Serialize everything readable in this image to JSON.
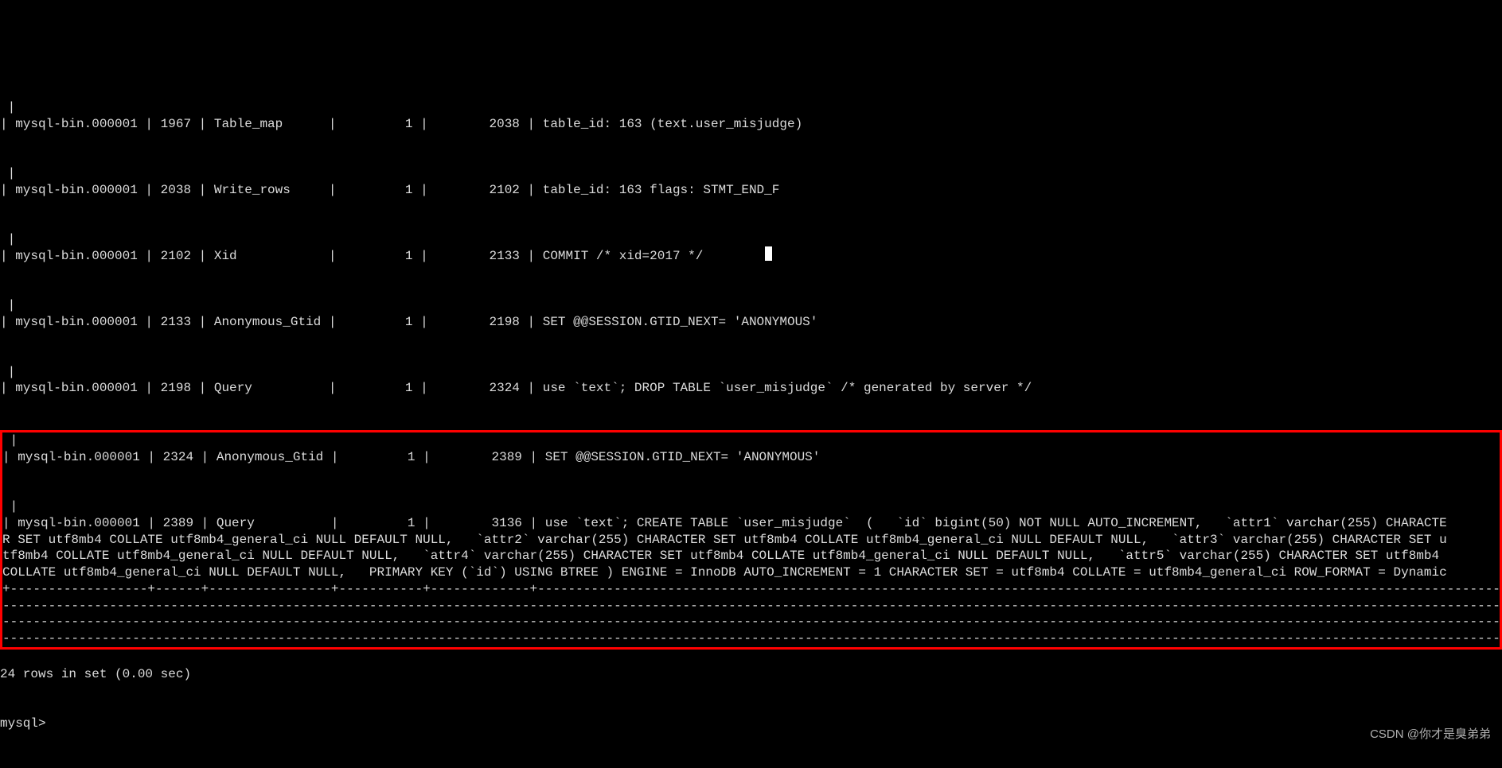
{
  "rows": [
    {
      "line1": " |",
      "line2": "| mysql-bin.000001 | 1967 | Table_map      |         1 |        2038 | table_id: 163 (text.user_misjudge)"
    },
    {
      "line1": " |",
      "line2": "| mysql-bin.000001 | 2038 | Write_rows     |         1 |        2102 | table_id: 163 flags: STMT_END_F"
    },
    {
      "line1": " |",
      "line2": "| mysql-bin.000001 | 2102 | Xid            |         1 |        2133 | COMMIT /* xid=2017 */"
    },
    {
      "line1": " |",
      "line2": "| mysql-bin.000001 | 2133 | Anonymous_Gtid |         1 |        2198 | SET @@SESSION.GTID_NEXT= 'ANONYMOUS'"
    },
    {
      "line1": " |",
      "line2": "| mysql-bin.000001 | 2198 | Query          |         1 |        2324 | use `text`; DROP TABLE `user_misjudge` /* generated by server */"
    }
  ],
  "hrows": [
    {
      "line1": " |",
      "line2": "| mysql-bin.000001 | 2324 | Anonymous_Gtid |         1 |        2389 | SET @@SESSION.GTID_NEXT= 'ANONYMOUS'"
    },
    {
      "line1": " |",
      "line2": "| mysql-bin.000001 | 2389 | Query          |         1 |        3136 | use `text`; CREATE TABLE `user_misjudge`  (   `id` bigint(50) NOT NULL AUTO_INCREMENT,   `attr1` varchar(255) CHARACTE",
      "line3": "R SET utf8mb4 COLLATE utf8mb4_general_ci NULL DEFAULT NULL,   `attr2` varchar(255) CHARACTER SET utf8mb4 COLLATE utf8mb4_general_ci NULL DEFAULT NULL,   `attr3` varchar(255) CHARACTER SET u",
      "line4": "tf8mb4 COLLATE utf8mb4_general_ci NULL DEFAULT NULL,   `attr4` varchar(255) CHARACTER SET utf8mb4 COLLATE utf8mb4_general_ci NULL DEFAULT NULL,   `attr5` varchar(255) CHARACTER SET utf8mb4 ",
      "line5": "COLLATE utf8mb4_general_ci NULL DEFAULT NULL,   PRIMARY KEY (`id`) USING BTREE ) ENGINE = InnoDB AUTO_INCREMENT = 1 CHARACTER SET = utf8mb4 COLLATE = utf8mb4_general_ci ROW_FORMAT = Dynamic"
    }
  ],
  "sep1": "+------------------+------+----------------+-----------+-------------+-------------------------------------------------------------------------------------------------------------------------------------------------------------------------------------------------",
  "sep2": "-------------------------------------------------------------------------------------------------------------------------------------------------------------------------------------------------------------------------------------------------------------------------",
  "sep3": "-------------------------------------------------------------------------------------------------------------------------------------------------------------------------------------------------------------------------------------------------------------------------",
  "sep4": "-------------------------------------------------------------------------------------------------------------------------------------------------------------------------------------------------------------------------------------------------------------------------",
  "footer1": "24 rows in set (0.00 sec)",
  "footer_blank": "",
  "footer2": "mysql>",
  "watermark": "CSDN @你才是臭弟弟",
  "blank": ""
}
